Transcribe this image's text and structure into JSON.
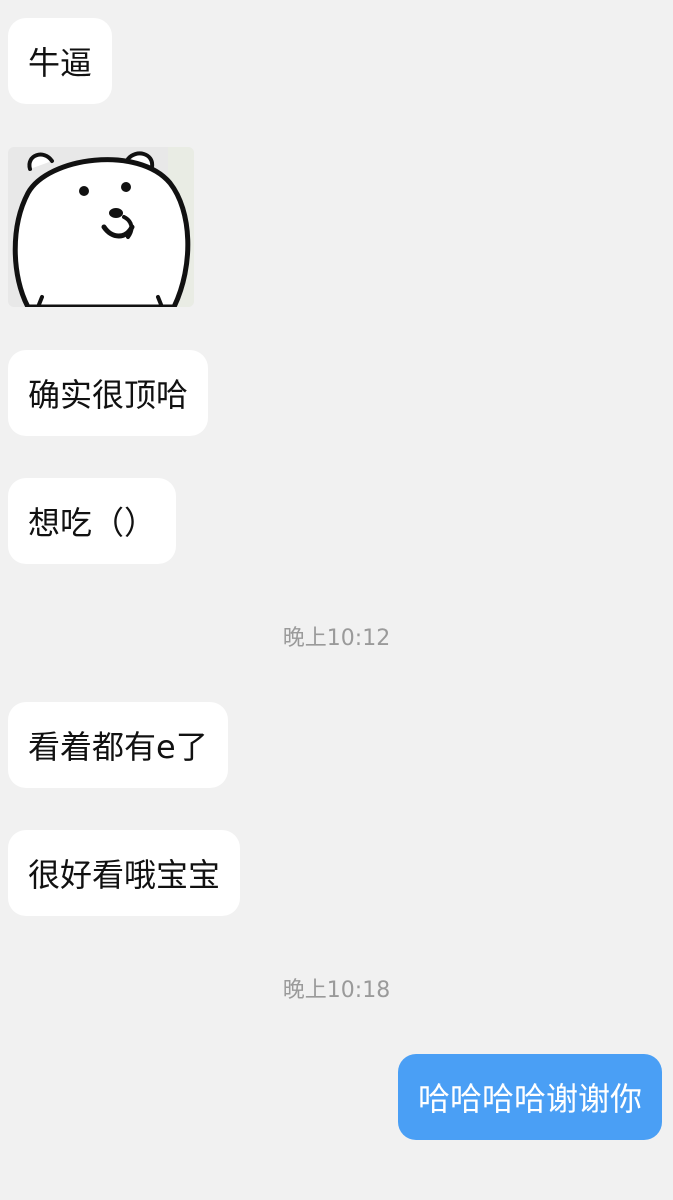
{
  "colors": {
    "background": "#f1f1f1",
    "incoming_bubble": "#ffffff",
    "outgoing_bubble": "#4a9ff5",
    "timestamp_text": "#9a9a9a"
  },
  "messages": [
    {
      "direction": "incoming",
      "type": "text",
      "text": "牛逼"
    },
    {
      "direction": "incoming",
      "type": "sticker",
      "sticker": "white-bear-smirk"
    },
    {
      "direction": "incoming",
      "type": "text",
      "text": "确实很顶哈"
    },
    {
      "direction": "incoming",
      "type": "text",
      "text": "想吃（）"
    },
    {
      "type": "timestamp",
      "text": "晚上10:12"
    },
    {
      "direction": "incoming",
      "type": "text",
      "text": "看着都有e了"
    },
    {
      "direction": "incoming",
      "type": "text",
      "text": "很好看哦宝宝"
    },
    {
      "type": "timestamp",
      "text": "晚上10:18"
    },
    {
      "direction": "outgoing",
      "type": "text",
      "text": "哈哈哈哈谢谢你"
    }
  ]
}
